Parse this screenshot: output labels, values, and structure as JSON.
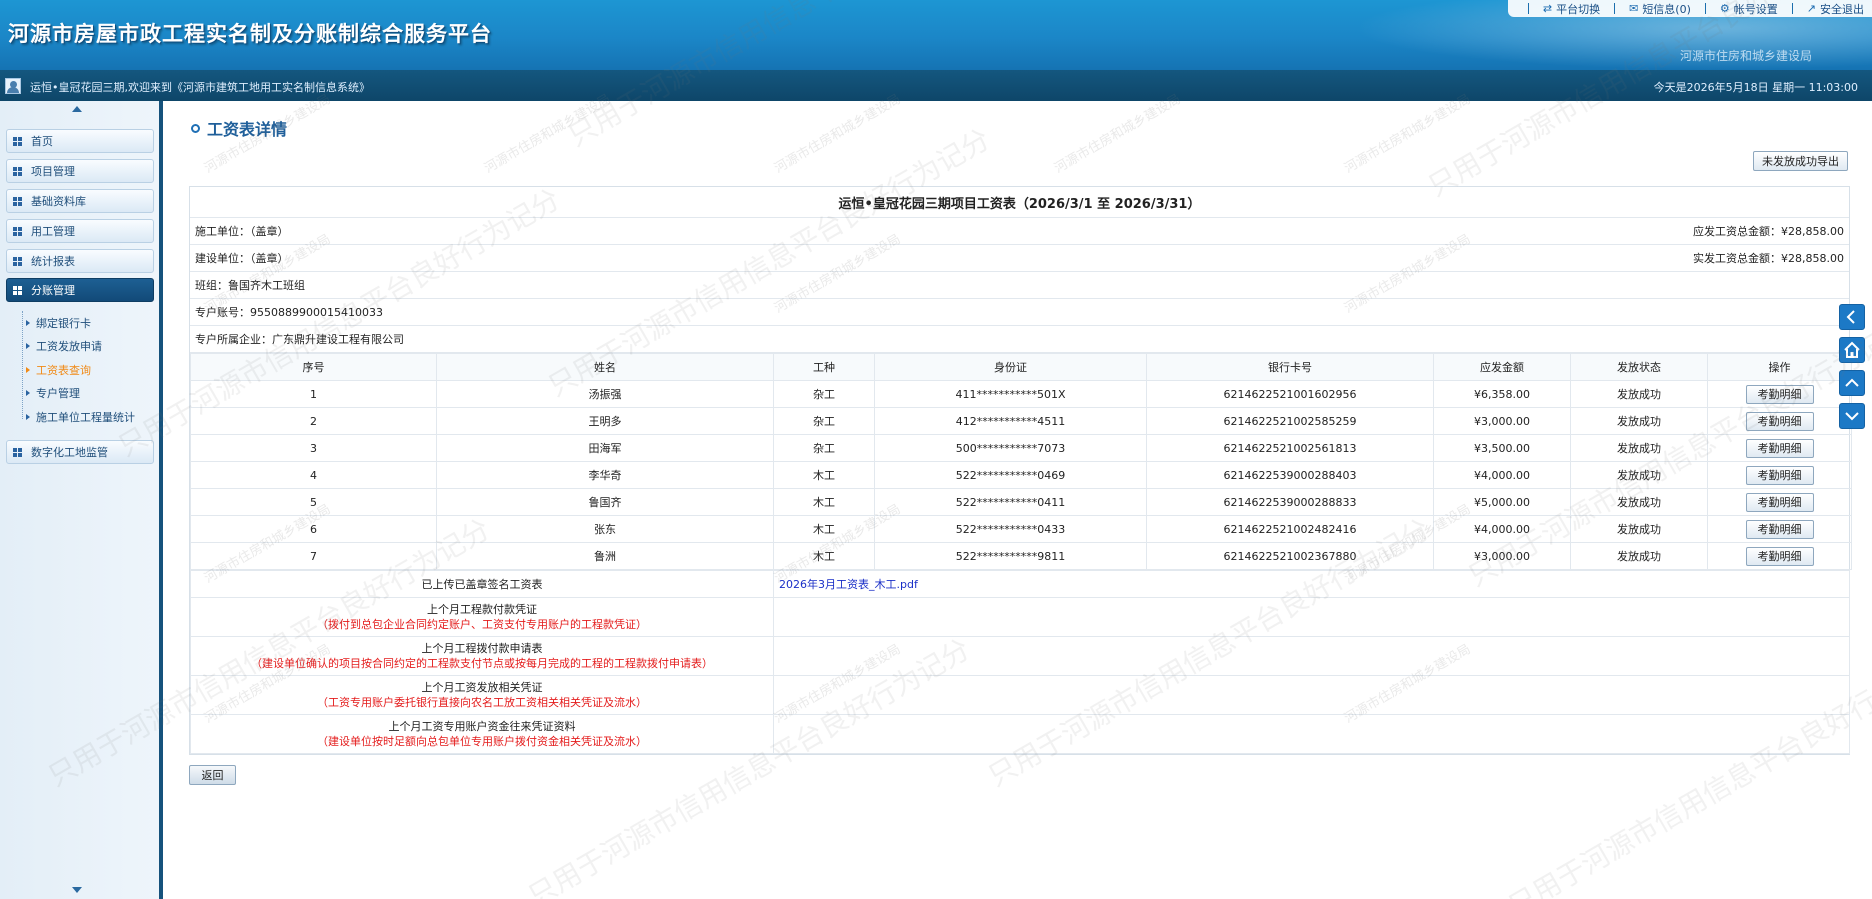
{
  "app": {
    "title": "河源市房屋市政工程实名制及分账制综合服务平台",
    "org": "河源市住房和城乡建设局"
  },
  "topnav": {
    "items": [
      {
        "label": "平台切换",
        "icon": "swap-icon"
      },
      {
        "label": "短信息(0)",
        "icon": "mail-icon"
      },
      {
        "label": "帐号设置",
        "icon": "gear-icon"
      },
      {
        "label": "安全退出",
        "icon": "logout-icon"
      }
    ]
  },
  "subbar": {
    "welcome": "运恒•皇冠花园三期,欢迎来到《河源市建筑工地用工实名制信息系统》",
    "date": "今天是2026年5月18日 星期一 11:03:00"
  },
  "sidebar": {
    "items": [
      {
        "label": "首页"
      },
      {
        "label": "项目管理"
      },
      {
        "label": "基础资料库"
      },
      {
        "label": "用工管理"
      },
      {
        "label": "统计报表"
      },
      {
        "label": "分账管理"
      },
      {
        "label": "数字化工地监管"
      }
    ],
    "submenu": [
      {
        "label": "绑定银行卡"
      },
      {
        "label": "工资发放申请"
      },
      {
        "label": "工资表查询"
      },
      {
        "label": "专户管理"
      },
      {
        "label": "施工单位工程量统计"
      }
    ]
  },
  "page": {
    "title": "工资表详情",
    "export_label": "未发放成功导出",
    "back_label": "返回"
  },
  "sheet": {
    "title": "运恒•皇冠花园三期项目工资表（2026/3/1 至 2026/3/31）",
    "contractor": "施工单位：（盖章）",
    "due_total": "应发工资总金额：¥28,858.00",
    "builder": "建设单位：（盖章）",
    "paid_total": "实发工资总金额：¥28,858.00",
    "team": "班组：鲁国齐木工班组",
    "account": "专户账号：9550889900015410033",
    "account_company": "专户所属企业：广东鼎升建设工程有限公司",
    "headers": [
      "序号",
      "姓名",
      "工种",
      "身份证",
      "银行卡号",
      "应发金额",
      "发放状态",
      "操作"
    ],
    "rows": [
      {
        "no": "1",
        "name": "汤振强",
        "type": "杂工",
        "id": "411***********501X",
        "card": "6214622521001602956",
        "amount": "¥6,358.00",
        "status": "发放成功",
        "action": "考勤明细"
      },
      {
        "no": "2",
        "name": "王明多",
        "type": "杂工",
        "id": "412***********4511",
        "card": "6214622521002585259",
        "amount": "¥3,000.00",
        "status": "发放成功",
        "action": "考勤明细"
      },
      {
        "no": "3",
        "name": "田海军",
        "type": "杂工",
        "id": "500***********7073",
        "card": "6214622521002561813",
        "amount": "¥3,500.00",
        "status": "发放成功",
        "action": "考勤明细"
      },
      {
        "no": "4",
        "name": "李华奇",
        "type": "木工",
        "id": "522***********0469",
        "card": "6214622539000288403",
        "amount": "¥4,000.00",
        "status": "发放成功",
        "action": "考勤明细"
      },
      {
        "no": "5",
        "name": "鲁国齐",
        "type": "木工",
        "id": "522***********0411",
        "card": "6214622539000288833",
        "amount": "¥5,000.00",
        "status": "发放成功",
        "action": "考勤明细"
      },
      {
        "no": "6",
        "name": "张东",
        "type": "木工",
        "id": "522***********0433",
        "card": "6214622521002482416",
        "amount": "¥4,000.00",
        "status": "发放成功",
        "action": "考勤明细"
      },
      {
        "no": "7",
        "name": "鲁洲",
        "type": "木工",
        "id": "522***********9811",
        "card": "6214622521002367880",
        "amount": "¥3,000.00",
        "status": "发放成功",
        "action": "考勤明细"
      }
    ],
    "docs": [
      {
        "label": "已上传已盖章签名工资表",
        "note": "",
        "link": "2026年3月工资表_木工.pdf"
      },
      {
        "label": "上个月工程款付款凭证",
        "note": "（拨付到总包企业合同约定账户、工资支付专用账户的工程款凭证）",
        "link": ""
      },
      {
        "label": "上个月工程拨付款申请表",
        "note": "（建设单位确认的项目按合同约定的工程款支付节点或按每月完成的工程的工程款拨付申请表）",
        "link": ""
      },
      {
        "label": "上个月工资发放相关凭证",
        "note": "（工资专用账户委托银行直接向农名工放工资相关相关凭证及流水）",
        "link": ""
      },
      {
        "label": "上个月工资专用账户资金往来凭证资料",
        "note": "（建设单位按时足额向总包单位专用账户拨付资金相关凭证及流水）",
        "link": ""
      }
    ]
  },
  "watermark": {
    "big": "只用于河源市信用信息平台良好行为记分",
    "small": "河源市住房和城乡建设局"
  },
  "colors": {
    "header": "#1b86c7",
    "subbar": "#14577f",
    "accent": "#1c79c6",
    "current_submenu": "#f08a16",
    "note_red": "#e41c1c"
  }
}
